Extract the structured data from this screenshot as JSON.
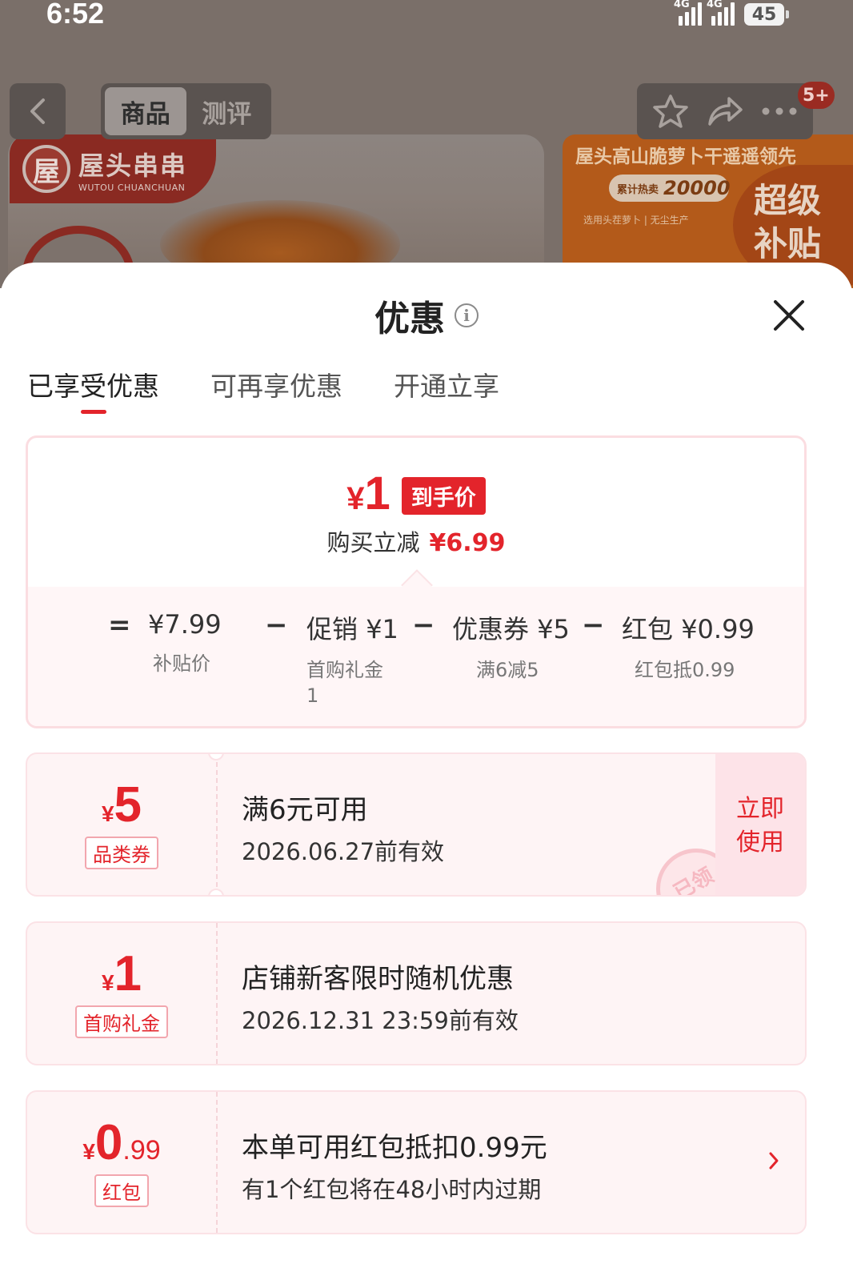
{
  "status_bar": {
    "time": "6:52",
    "net1": "4G",
    "net2": "4G",
    "battery": "45"
  },
  "nav": {
    "tabs": [
      {
        "label": "商品",
        "active": true
      },
      {
        "label": "测评",
        "active": false
      }
    ],
    "badge": "5+"
  },
  "background": {
    "brand_cn": "屋头串串",
    "brand_en": "WUTOU CHUANCHUAN",
    "brand_mark": "屋",
    "ad_title": "屋头高山脆萝卜干遥遥领先",
    "ad_pill_label": "累计热卖",
    "ad_pill_num": "20000",
    "ad_sub": "选用头茬萝卜 | 无尘生产",
    "ad_badge_line1": "超级",
    "ad_badge_line2": "补贴"
  },
  "sheet": {
    "title": "优惠",
    "info_icon": "i",
    "tabs": [
      {
        "label": "已享受优惠",
        "active": true
      },
      {
        "label": "可再享优惠",
        "active": false
      },
      {
        "label": "开通立享",
        "active": false
      }
    ]
  },
  "price_card": {
    "final_yen": "¥",
    "final_value": "1",
    "final_tag": "到手价",
    "instant_label": "购买立减",
    "instant_value": "¥6.99",
    "breakdown": [
      {
        "op": "=",
        "label": "",
        "value": "¥7.99",
        "sub": "补贴价"
      },
      {
        "op": "−",
        "label": "促销",
        "value": "¥1",
        "sub": "首购礼金\n1"
      },
      {
        "op": "−",
        "label": "优惠券",
        "value": "¥5",
        "sub": "满6减5"
      },
      {
        "op": "−",
        "label": "红包",
        "value": "¥0.99",
        "sub": "红包抵0.99"
      }
    ]
  },
  "coupons": [
    {
      "yen": "¥",
      "amount": "5",
      "decimal": "",
      "type": "品类券",
      "title": "满6元可用",
      "desc": "2026.06.27前有效",
      "action_line1": "立即",
      "action_line2": "使用",
      "stamp": "已领"
    },
    {
      "yen": "¥",
      "amount": "1",
      "decimal": "",
      "type": "首购礼金",
      "title": "店铺新客限时随机优惠",
      "desc": "2026.12.31 23:59前有效"
    },
    {
      "yen": "¥",
      "amount": "0",
      "decimal": ".99",
      "type": "红包",
      "title": "本单可用红包抵扣0.99元",
      "desc": "有1个红包将在48小时内过期"
    }
  ],
  "colors": {
    "accent": "#e3242b",
    "card_bg": "#fef4f5",
    "overlay": "#7a6f69"
  },
  "icons": [
    "back-arrow-icon",
    "star-icon",
    "share-icon",
    "more-icon",
    "info-icon",
    "close-icon",
    "chevron-right-icon"
  ]
}
